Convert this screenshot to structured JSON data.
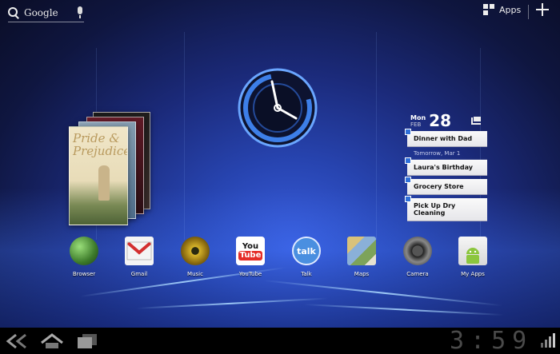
{
  "search": {
    "label": "Google"
  },
  "topbar": {
    "apps_label": "Apps"
  },
  "book": {
    "title_line1": "Pride",
    "title_line2": "Prejudice",
    "amp": "&"
  },
  "calendar": {
    "day_of_week": "Mon",
    "month": "FEB",
    "day": "28",
    "events": [
      {
        "title": "Dinner with Dad"
      },
      {
        "title": "Laura's Birthday"
      },
      {
        "title": "Grocery Store"
      },
      {
        "title": "Pick Up Dry Cleaning"
      }
    ],
    "separator": "Tomorrow, Mar 1"
  },
  "dock": {
    "apps": [
      {
        "label": "Browser",
        "icon": "globe-icon"
      },
      {
        "label": "Gmail",
        "icon": "gmail-icon"
      },
      {
        "label": "Music",
        "icon": "music-icon"
      },
      {
        "label": "YouTube",
        "icon": "youtube-icon",
        "icon_text_top": "You",
        "icon_text_bottom": "Tube"
      },
      {
        "label": "Talk",
        "icon": "talk-icon",
        "icon_text": "talk"
      },
      {
        "label": "Maps",
        "icon": "maps-icon"
      },
      {
        "label": "Camera",
        "icon": "camera-icon"
      },
      {
        "label": "My Apps",
        "icon": "android-market-icon"
      }
    ]
  },
  "statusbar": {
    "time": "3:59"
  },
  "colors": {
    "accent": "#2f6fd8",
    "youtube_red": "#e52d27",
    "talk_blue": "#4a8fe0"
  }
}
